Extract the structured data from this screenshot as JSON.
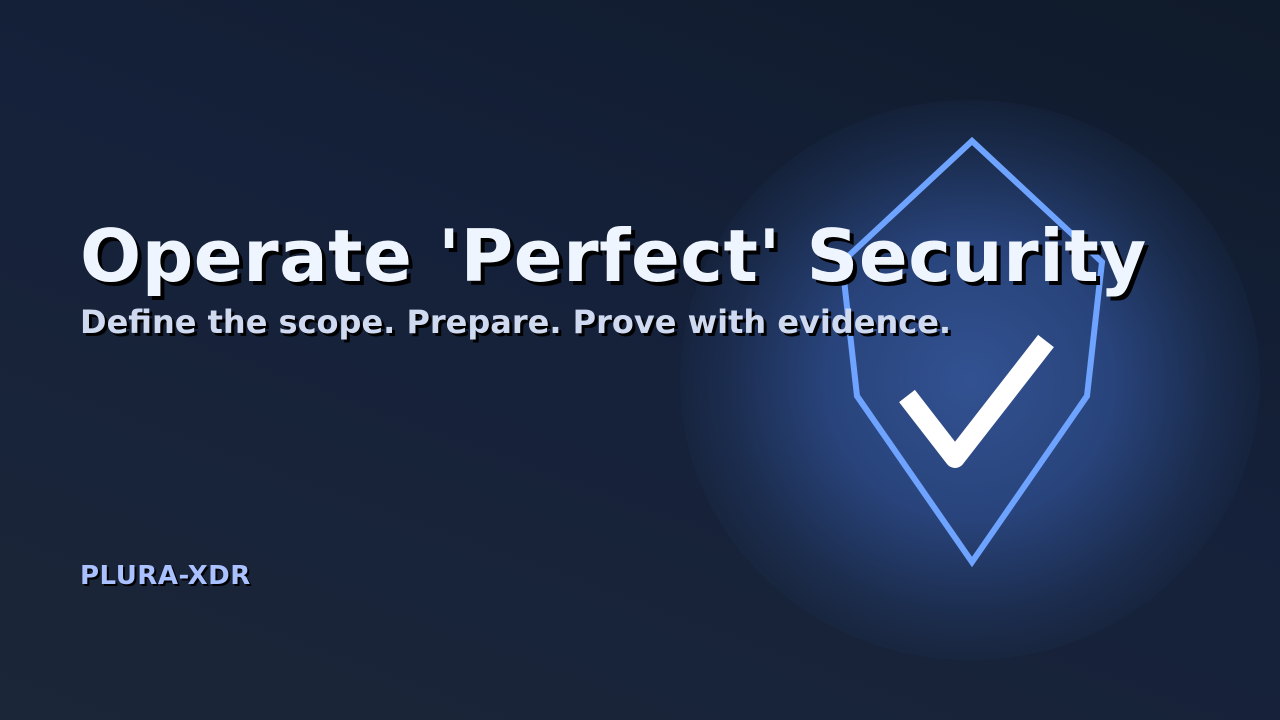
{
  "hero": {
    "title": "Operate 'Perfect' Security",
    "subtitle": "Define the scope. Prepare. Prove with evidence."
  },
  "brand": {
    "name": "PLURA-XDR"
  },
  "emblem": {
    "icon": "shield-check-icon",
    "outline_color": "#6ea3ff",
    "check_color": "#ffffff",
    "glow_color": "#2e4a86"
  },
  "colors": {
    "background": "#15213a",
    "title": "#eef5ff",
    "subtitle": "#cfdaf0",
    "brand": "#a9c1ff"
  }
}
